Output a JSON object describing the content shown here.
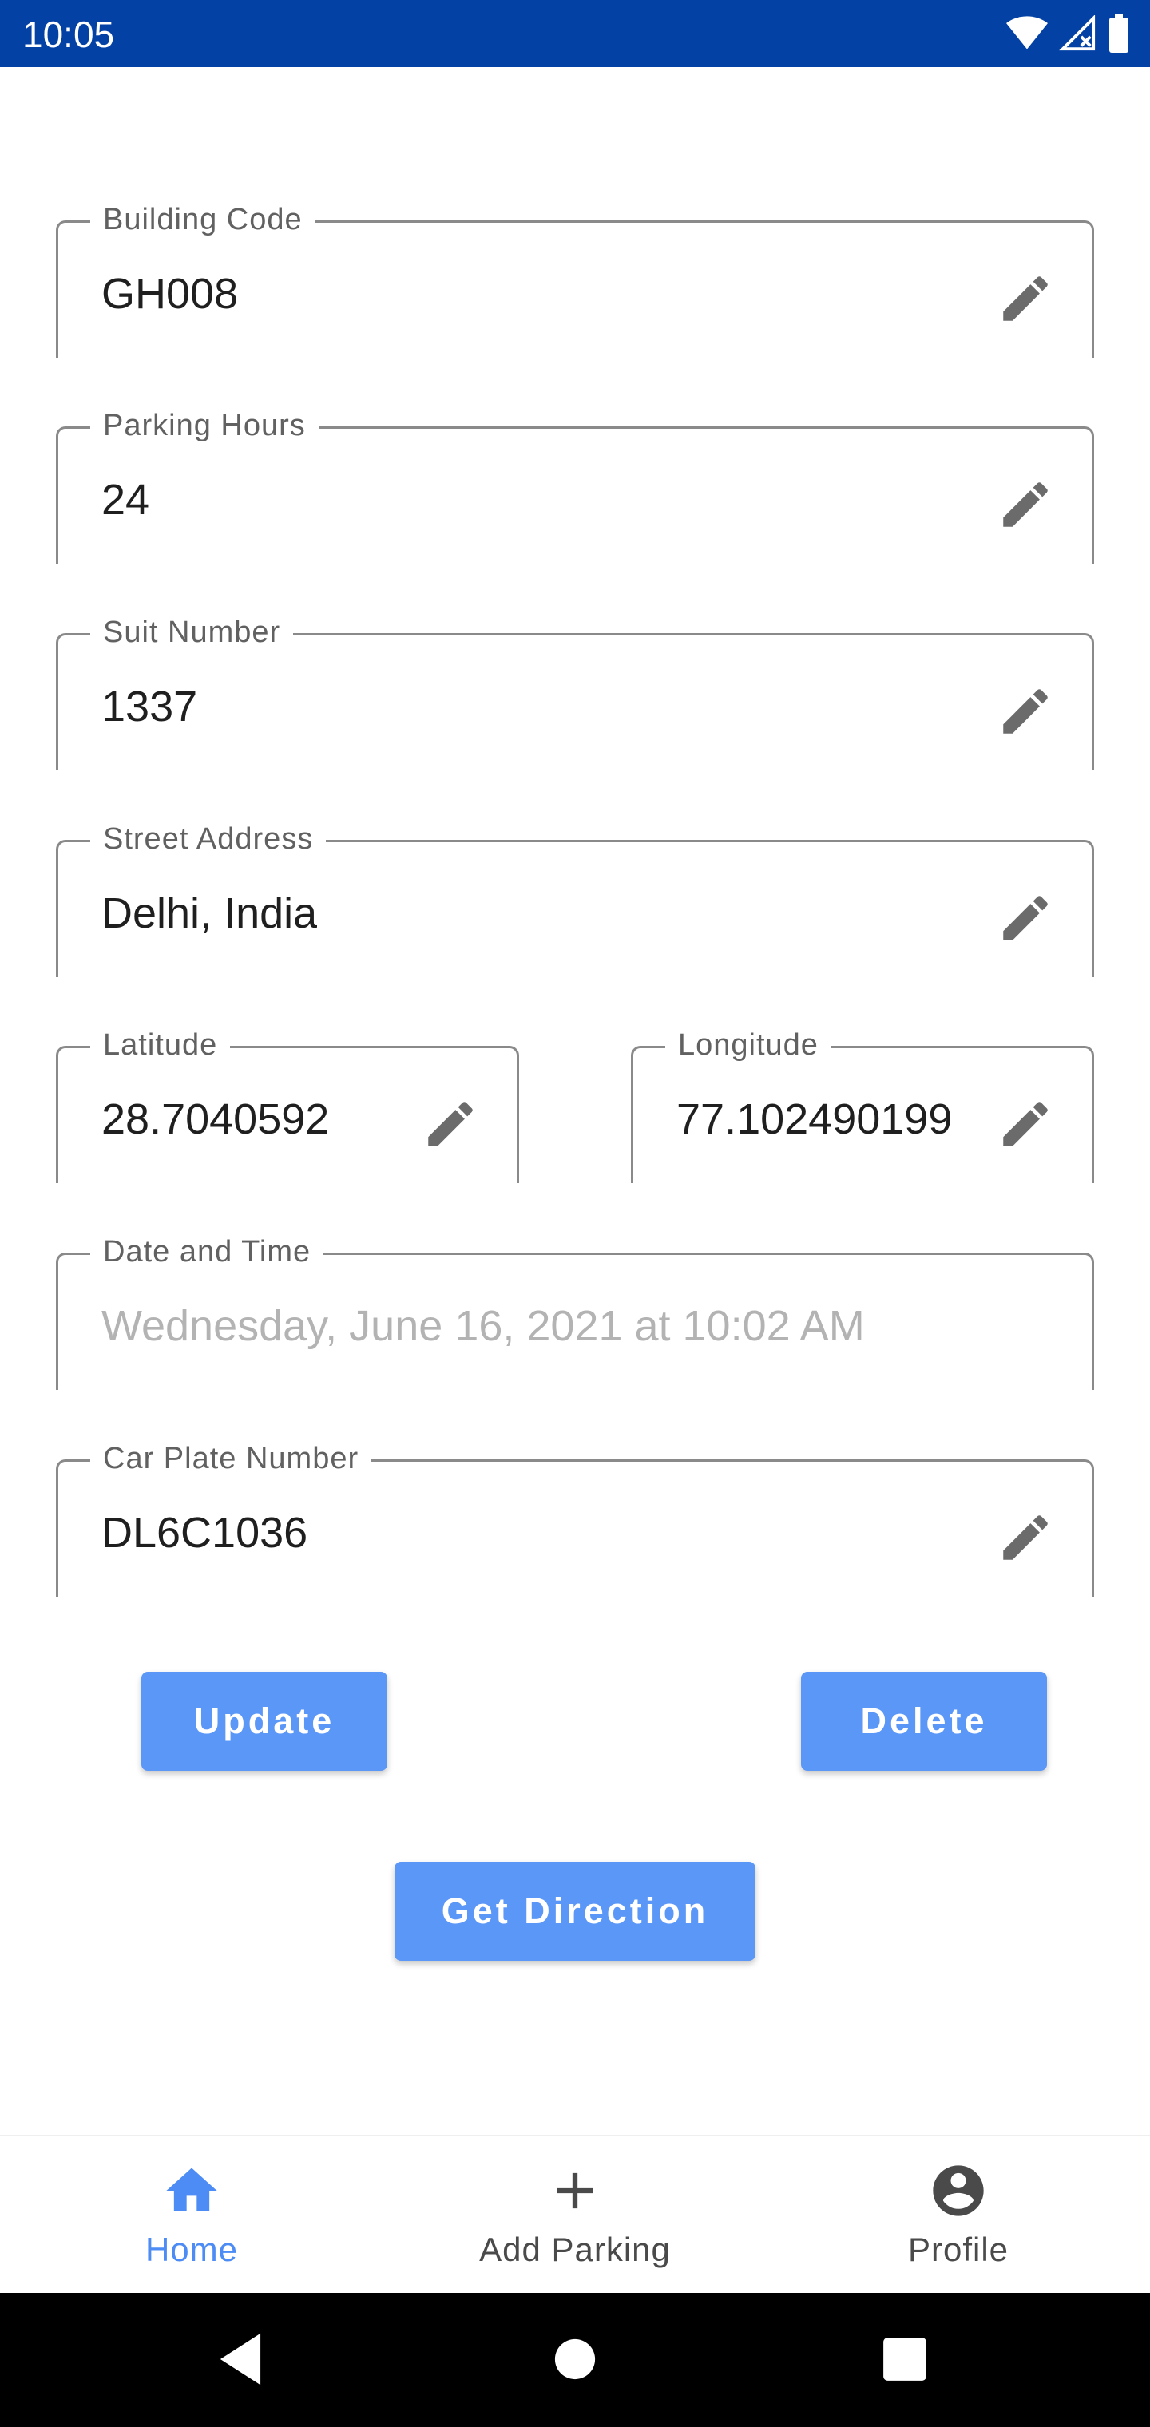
{
  "status_bar": {
    "time": "10:05",
    "icons": [
      "wifi-icon",
      "signal-icon",
      "battery-icon"
    ]
  },
  "form": {
    "building_code": {
      "label": "Building Code",
      "value": "GH008"
    },
    "parking_hours": {
      "label": "Parking Hours",
      "value": "24"
    },
    "suit_number": {
      "label": "Suit Number",
      "value": "1337"
    },
    "street_address": {
      "label": "Street Address",
      "value": "Delhi, India"
    },
    "latitude": {
      "label": "Latitude",
      "value": "28.7040592"
    },
    "longitude": {
      "label": "Longitude",
      "value": "77.102490199"
    },
    "date_time": {
      "label": "Date and Time",
      "value": "Wednesday, June 16, 2021 at 10:02 AM"
    },
    "car_plate": {
      "label": "Car Plate Number",
      "value": "DL6C1036"
    }
  },
  "actions": {
    "update": "Update",
    "delete": "Delete",
    "get_direction": "Get Direction"
  },
  "bottom_nav": {
    "items": [
      {
        "label": "Home",
        "icon": "home-icon",
        "active": true
      },
      {
        "label": "Add Parking",
        "icon": "plus-icon",
        "active": false
      },
      {
        "label": "Profile",
        "icon": "account-circle-icon",
        "active": false
      }
    ]
  },
  "system_nav": [
    "back-icon",
    "home-circle-icon",
    "recents-icon"
  ],
  "colors": {
    "status_bar": "#0341a5",
    "accent": "#5b97f7",
    "active_nav": "#4d8cf5",
    "outline": "#8a8a8a"
  }
}
